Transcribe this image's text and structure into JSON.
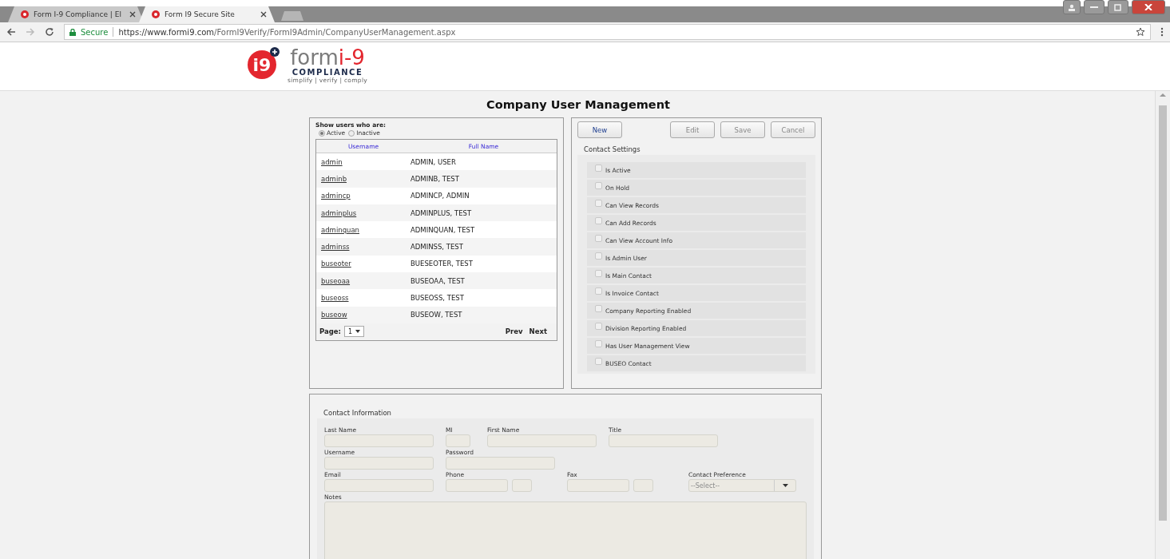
{
  "browser": {
    "tabs": [
      {
        "title": "Form I-9 Compliance | El",
        "selected": false
      },
      {
        "title": "Form I9 Secure Site",
        "selected": true
      }
    ],
    "security": "Secure",
    "url": "**https://www.formi9.com**/FormI9Verify/FormI9Admin/CompanyUserManagement.aspx"
  },
  "logo": {
    "badge": "i9",
    "word": "form",
    "accent": "i-9",
    "tagline_top": "COMPLIANCE",
    "tagline": "simplify | verify | comply"
  },
  "page_title": "Company User Management",
  "user_list": {
    "filter_label": "Show users who are:",
    "filter_options": [
      {
        "label": "Active",
        "selected": true
      },
      {
        "label": "Inactive",
        "selected": false
      }
    ],
    "columns": [
      "Username",
      "Full Name"
    ],
    "rows": [
      {
        "username": "admin",
        "full_name": "ADMIN, USER"
      },
      {
        "username": "adminb",
        "full_name": "ADMINB, TEST"
      },
      {
        "username": "admincp",
        "full_name": "ADMINCP, ADMIN"
      },
      {
        "username": "adminplus",
        "full_name": "ADMINPLUS, TEST"
      },
      {
        "username": "adminquan",
        "full_name": "ADMINQUAN, TEST"
      },
      {
        "username": "adminss",
        "full_name": "ADMINSS, TEST"
      },
      {
        "username": "buseoter",
        "full_name": "BUESEOTER, TEST"
      },
      {
        "username": "buseoaa",
        "full_name": "BUSEOAA, TEST"
      },
      {
        "username": "buseoss",
        "full_name": "BUSEOSS, TEST"
      },
      {
        "username": "buseow",
        "full_name": "BUSEOW, TEST"
      }
    ],
    "page_label": "Page:",
    "page_value": "1",
    "prev": "Prev",
    "next": "Next"
  },
  "actions": [
    {
      "label": "New",
      "primary": true
    },
    {
      "label": "Edit",
      "primary": false
    },
    {
      "label": "Save",
      "primary": false
    },
    {
      "label": "Cancel",
      "primary": false
    }
  ],
  "contact_settings": {
    "title": "Contact Settings",
    "options": [
      {
        "label": "Is Active",
        "checked": false
      },
      {
        "label": "On Hold",
        "checked": false
      },
      {
        "label": "Can View Records",
        "checked": false
      },
      {
        "label": "Can Add Records",
        "checked": false
      },
      {
        "label": "Can View Account Info",
        "checked": false
      },
      {
        "label": "Is Admin User",
        "checked": false
      },
      {
        "label": "Is Main Contact",
        "checked": false
      },
      {
        "label": "Is Invoice Contact",
        "checked": false
      },
      {
        "label": "Company Reporting Enabled",
        "checked": false
      },
      {
        "label": "Division Reporting Enabled",
        "checked": false
      },
      {
        "label": "Has User Management View",
        "checked": false
      },
      {
        "label": "BUSEO Contact",
        "checked": false
      }
    ]
  },
  "contact_information": {
    "title": "Contact Information",
    "rows": [
      [
        {
          "label": "Last Name",
          "kind": "text"
        },
        {
          "label": "MI",
          "kind": "short"
        },
        {
          "label": "First Name",
          "kind": "text"
        },
        {
          "label": "Title",
          "kind": "text"
        }
      ],
      [
        {
          "label": "Username",
          "kind": "text"
        },
        {
          "label": "Password",
          "kind": "text"
        }
      ],
      [
        {
          "label": "Email",
          "kind": "text"
        },
        {
          "label": "Phone",
          "kind": "phone"
        },
        {
          "label": "Fax",
          "kind": "phone"
        },
        {
          "label": "Contact Preference",
          "kind": "select",
          "placeholder": "--Select--"
        }
      ],
      [
        {
          "label": "Notes",
          "kind": "textarea"
        }
      ]
    ]
  }
}
